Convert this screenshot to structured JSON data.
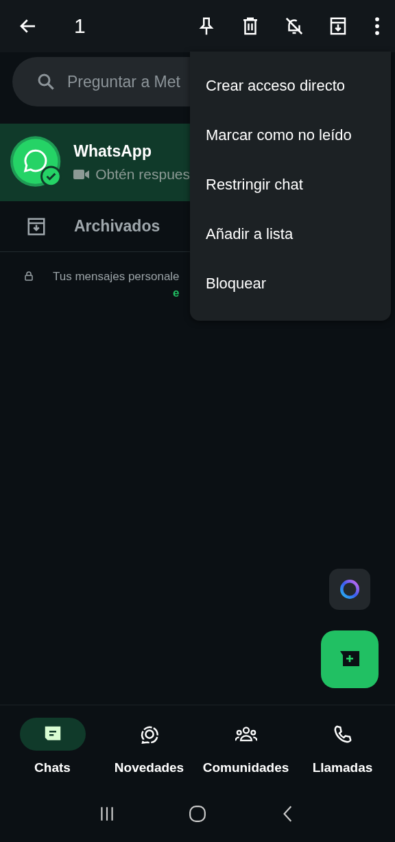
{
  "toolbar": {
    "count": "1"
  },
  "search": {
    "placeholder": "Preguntar a Met"
  },
  "chats": [
    {
      "name": "WhatsApp",
      "preview": "Obtén respues",
      "selected": true
    }
  ],
  "archived": {
    "label": "Archivados"
  },
  "encryption_notice": {
    "text": "Tus mensajes personale",
    "link": "e"
  },
  "menu": {
    "items": [
      "Crear acceso directo",
      "Marcar como no leído",
      "Restringir chat",
      "Añadir a lista",
      "Bloquear"
    ]
  },
  "bottom_nav": [
    {
      "label": "Chats",
      "selected": true
    },
    {
      "label": "Novedades",
      "selected": false
    },
    {
      "label": "Comunidades",
      "selected": false
    },
    {
      "label": "Llamadas",
      "selected": false
    }
  ]
}
